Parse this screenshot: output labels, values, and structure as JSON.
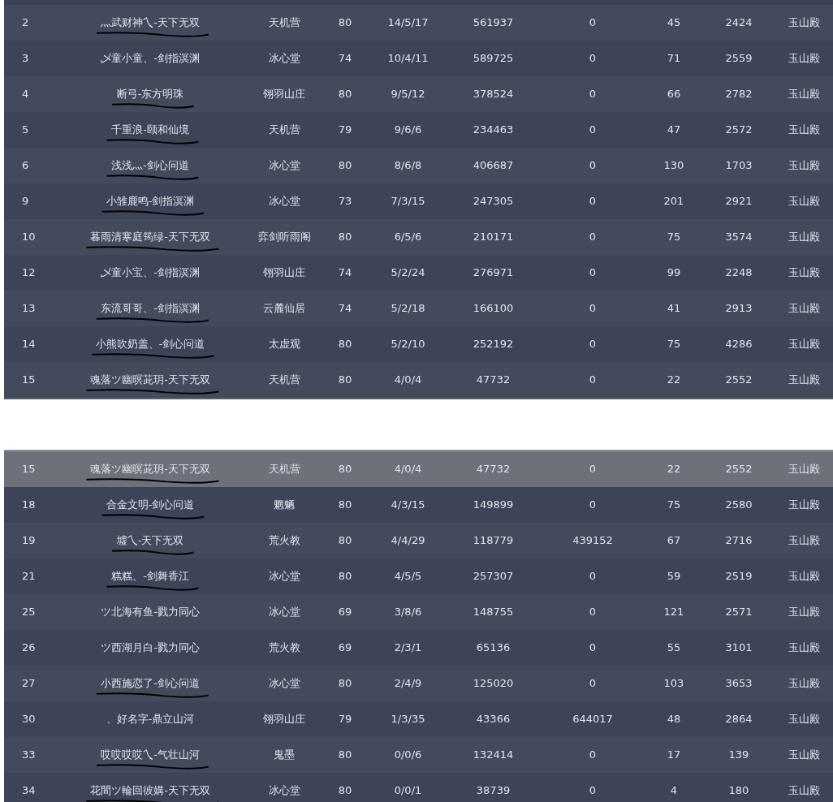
{
  "panels": [
    {
      "rows": [
        {
          "cells": [
            "2",
            "灬武财神乀-天下无双",
            "天机营",
            "80",
            "14/5/17",
            "561937",
            "0",
            "45",
            "2424",
            "玉山殿"
          ],
          "scribbled": true,
          "highlighted": false
        },
        {
          "cells": [
            "3",
            "乄童小童、-剑指溟渊",
            "冰心堂",
            "74",
            "10/4/11",
            "589725",
            "0",
            "71",
            "2559",
            "玉山殿"
          ],
          "scribbled": false,
          "highlighted": false
        },
        {
          "cells": [
            "4",
            "断弓-东方明珠",
            "翎羽山庄",
            "80",
            "9/5/12",
            "378524",
            "0",
            "66",
            "2782",
            "玉山殿"
          ],
          "scribbled": true,
          "highlighted": false
        },
        {
          "cells": [
            "5",
            "千重浪-颐和仙境",
            "天机营",
            "79",
            "9/6/6",
            "234463",
            "0",
            "47",
            "2572",
            "玉山殿"
          ],
          "scribbled": true,
          "highlighted": false
        },
        {
          "cells": [
            "6",
            "浅浅灬-剑心问道",
            "冰心堂",
            "80",
            "8/6/8",
            "406687",
            "0",
            "130",
            "1703",
            "玉山殿"
          ],
          "scribbled": true,
          "highlighted": false
        },
        {
          "cells": [
            "9",
            "小雏鹿鸣-剑指溟渊",
            "冰心堂",
            "73",
            "7/3/15",
            "247305",
            "0",
            "201",
            "2921",
            "玉山殿"
          ],
          "scribbled": true,
          "highlighted": false
        },
        {
          "cells": [
            "10",
            "暮雨清寒庭筠绿-天下无双",
            "弈剑听雨阁",
            "80",
            "6/5/6",
            "210171",
            "0",
            "75",
            "3574",
            "玉山殿"
          ],
          "scribbled": true,
          "highlighted": false
        },
        {
          "cells": [
            "12",
            "乄童小宝、-剑指溟渊",
            "翎羽山庄",
            "74",
            "5/2/24",
            "276971",
            "0",
            "99",
            "2248",
            "玉山殿"
          ],
          "scribbled": false,
          "highlighted": false
        },
        {
          "cells": [
            "13",
            "东流哥哥、-剑指溟渊",
            "云麓仙居",
            "74",
            "5/2/18",
            "166100",
            "0",
            "41",
            "2913",
            "玉山殿"
          ],
          "scribbled": true,
          "highlighted": false
        },
        {
          "cells": [
            "14",
            "小熊吹奶盖、-剑心问道",
            "太虚观",
            "80",
            "5/2/10",
            "252192",
            "0",
            "75",
            "4286",
            "玉山殿"
          ],
          "scribbled": true,
          "highlighted": false
        },
        {
          "cells": [
            "15",
            "魂落ツ幽暝茈玥-天下无双",
            "天机营",
            "80",
            "4/0/4",
            "47732",
            "0",
            "22",
            "2552",
            "玉山殿"
          ],
          "scribbled": true,
          "highlighted": false
        }
      ]
    },
    {
      "rows": [
        {
          "cells": [
            "15",
            "魂落ツ幽暝茈玥-天下无双",
            "天机营",
            "80",
            "4/0/4",
            "47732",
            "0",
            "22",
            "2552",
            "玉山殿"
          ],
          "scribbled": true,
          "highlighted": true
        },
        {
          "cells": [
            "18",
            "合金文明-剑心问道",
            "魍魉",
            "80",
            "4/3/15",
            "149899",
            "0",
            "75",
            "2580",
            "玉山殿"
          ],
          "scribbled": true,
          "highlighted": false
        },
        {
          "cells": [
            "19",
            "墟乀-天下无双",
            "荒火教",
            "80",
            "4/4/29",
            "118779",
            "439152",
            "67",
            "2716",
            "玉山殿"
          ],
          "scribbled": true,
          "highlighted": false
        },
        {
          "cells": [
            "21",
            "糕糕、-剑舞香江",
            "冰心堂",
            "80",
            "4/5/5",
            "257307",
            "0",
            "59",
            "2519",
            "玉山殿"
          ],
          "scribbled": true,
          "highlighted": false
        },
        {
          "cells": [
            "25",
            "ツ北海有鱼-戮力同心",
            "冰心堂",
            "69",
            "3/8/6",
            "148755",
            "0",
            "121",
            "2571",
            "玉山殿"
          ],
          "scribbled": false,
          "highlighted": false
        },
        {
          "cells": [
            "26",
            "ツ西湖月白-戮力同心",
            "荒火教",
            "69",
            "2/3/1",
            "65136",
            "0",
            "55",
            "3101",
            "玉山殿"
          ],
          "scribbled": false,
          "highlighted": false
        },
        {
          "cells": [
            "27",
            "小西施恋了-剑心问道",
            "冰心堂",
            "80",
            "2/4/9",
            "125020",
            "0",
            "103",
            "3653",
            "玉山殿"
          ],
          "scribbled": true,
          "highlighted": false
        },
        {
          "cells": [
            "30",
            "、好名字-鼎立山河",
            "翎羽山庄",
            "79",
            "1/3/35",
            "43366",
            "644017",
            "48",
            "2864",
            "玉山殿"
          ],
          "scribbled": false,
          "highlighted": false
        },
        {
          "cells": [
            "33",
            "哎哎哎哎乀-气壮山河",
            "鬼墨",
            "80",
            "0/0/6",
            "132414",
            "0",
            "17",
            "139",
            "玉山殿"
          ],
          "scribbled": true,
          "highlighted": false
        },
        {
          "cells": [
            "34",
            "花間ツ輪回彼媾-天下无双",
            "冰心堂",
            "80",
            "0/0/1",
            "38739",
            "0",
            "4",
            "180",
            "玉山殿"
          ],
          "scribbled": true,
          "highlighted": false
        }
      ]
    }
  ]
}
